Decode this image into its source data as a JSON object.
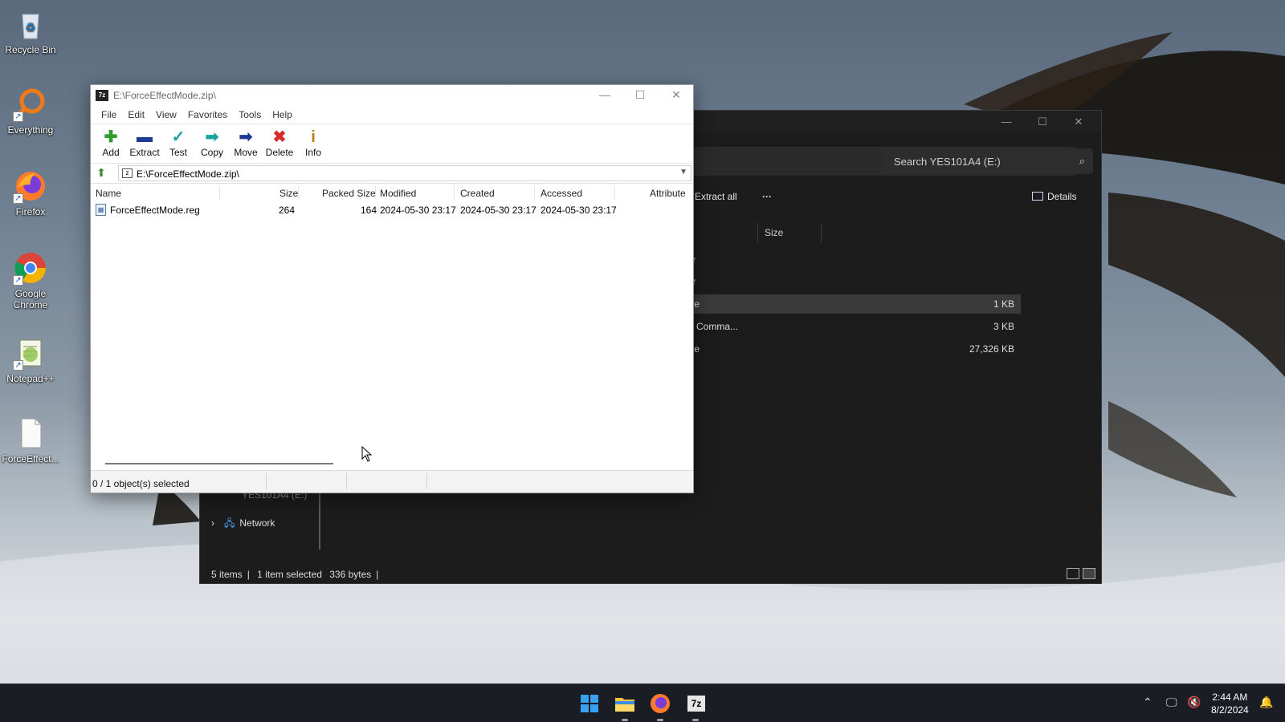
{
  "desktop": {
    "icons": [
      {
        "label": "Recycle Bin"
      },
      {
        "label": "Everything"
      },
      {
        "label": "Firefox"
      },
      {
        "label": "Google Chrome"
      },
      {
        "label": "Notepad++"
      },
      {
        "label": "ForceEffect..."
      }
    ]
  },
  "explorer": {
    "search_placeholder": "Search YES101A4 (E:)",
    "extract_all": "Extract all",
    "more": "···",
    "details": "Details",
    "columns": {
      "size": "Size"
    },
    "rows": [
      {
        "type": "der",
        "size": ""
      },
      {
        "type": "der",
        "size": ""
      },
      {
        "type": "hive",
        "size": "1 KB"
      },
      {
        "type": "ws Comma...",
        "size": "3 KB"
      },
      {
        "type": "hive",
        "size": "27,326 KB"
      }
    ],
    "nav": {
      "drive_partial": "YES101A4 (E:)",
      "network": "Network"
    },
    "status": {
      "items": "5 items",
      "selected": "1 item selected",
      "bytes": "336 bytes"
    }
  },
  "sevenzip": {
    "title": "E:\\ForceEffectMode.zip\\",
    "menu": [
      "File",
      "Edit",
      "View",
      "Favorites",
      "Tools",
      "Help"
    ],
    "toolbar": {
      "add": "Add",
      "extract": "Extract",
      "test": "Test",
      "copy": "Copy",
      "move": "Move",
      "delete": "Delete",
      "info": "Info"
    },
    "path": "E:\\ForceEffectMode.zip\\",
    "columns": {
      "name": "Name",
      "size": "Size",
      "packed": "Packed Size",
      "modified": "Modified",
      "created": "Created",
      "accessed": "Accessed",
      "attributes": "Attribute"
    },
    "files": [
      {
        "name": "ForceEffectMode.reg",
        "size": "264",
        "packed": "164",
        "modified": "2024-05-30 23:17",
        "created": "2024-05-30 23:17",
        "accessed": "2024-05-30 23:17"
      }
    ],
    "status": "0 / 1 object(s) selected"
  },
  "taskbar": {
    "time": "2:44 AM",
    "date": "8/2/2024",
    "sevenzip_label": "7z"
  },
  "colors": {
    "explorer_bg": "#1c1c1c",
    "taskbar_bg": "#1b1d24",
    "add_green": "#2e9e2e",
    "delete_red": "#d92b2b",
    "move_blue": "#1f3a93",
    "test_teal": "#1aa39a"
  }
}
